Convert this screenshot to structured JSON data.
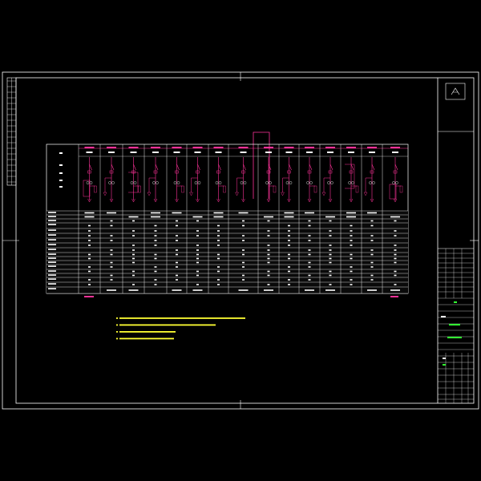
{
  "drawing": {
    "colors": {
      "background": "#000000",
      "frame": "#ffffff",
      "circuit": "#ff3399",
      "table_grid": "#ffffff",
      "table_fill": "#0a0a0a",
      "notes": "#ffff33",
      "stamp": "#33ff33",
      "breaker_marks": "#ffffff"
    },
    "row_header_labels": [
      "",
      "",
      "",
      "",
      "",
      "",
      "",
      "",
      "",
      "",
      "",
      "",
      "",
      "",
      "",
      "",
      "",
      ""
    ],
    "column_count": 16,
    "notes": [
      "",
      "",
      "",
      ""
    ],
    "stamp_text": [
      "",
      ""
    ],
    "logo_glyph": "",
    "footer_left_label": "",
    "footer_right_label": ""
  }
}
